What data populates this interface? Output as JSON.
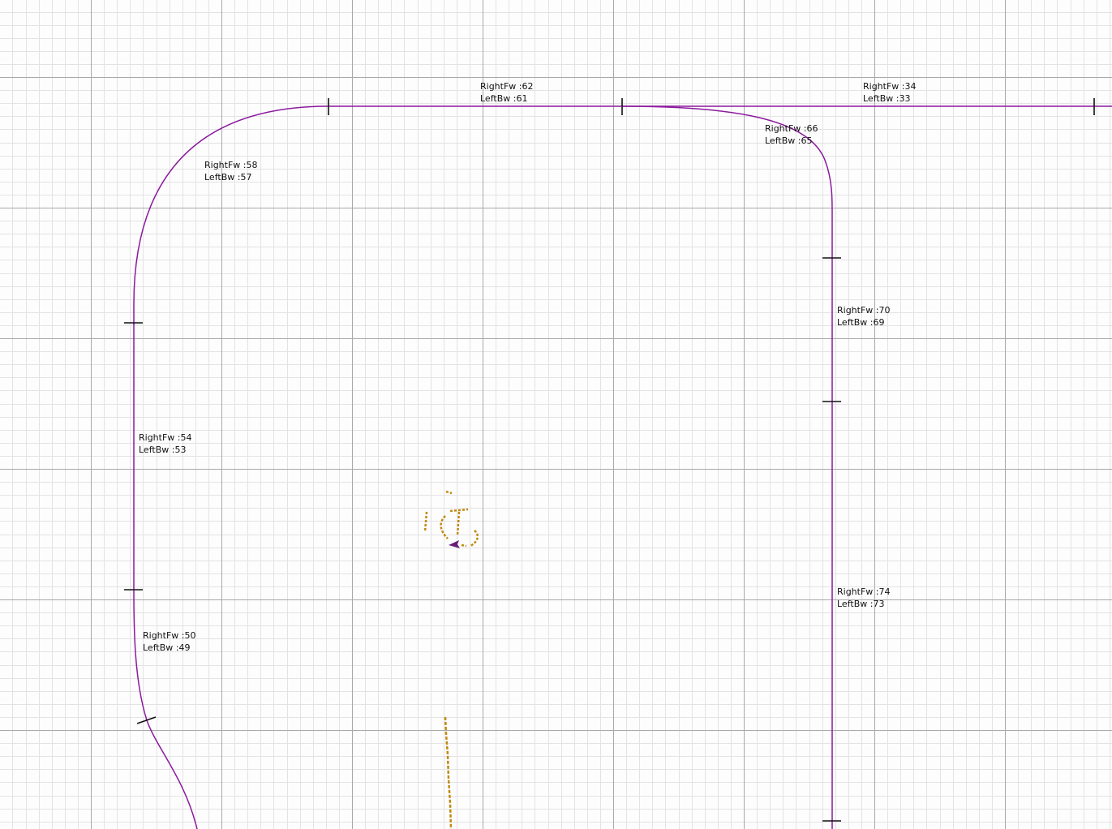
{
  "colors": {
    "background": "#fdfdfd",
    "minor_grid": "#e3e3e3",
    "major_grid": "#a9a9a9",
    "track": "#8b1a9e",
    "tick": "#111111",
    "scan_points": "#c08a10",
    "robot": "#6a1b78"
  },
  "segments": [
    {
      "id": "seg-62",
      "right_fw": "RightFw :62",
      "left_bw": "LeftBw :61"
    },
    {
      "id": "seg-34",
      "right_fw": "RightFw :34",
      "left_bw": "LeftBw :33"
    },
    {
      "id": "seg-66",
      "right_fw": "RightFw :66",
      "left_bw": "LeftBw :65"
    },
    {
      "id": "seg-58",
      "right_fw": "RightFw :58",
      "left_bw": "LeftBw :57"
    },
    {
      "id": "seg-70",
      "right_fw": "RightFw :70",
      "left_bw": "LeftBw :69"
    },
    {
      "id": "seg-54",
      "right_fw": "RightFw :54",
      "left_bw": "LeftBw :53"
    },
    {
      "id": "seg-74",
      "right_fw": "RightFw :74",
      "left_bw": "LeftBw :73"
    },
    {
      "id": "seg-50",
      "right_fw": "RightFw :50",
      "left_bw": "LeftBw :49"
    }
  ]
}
